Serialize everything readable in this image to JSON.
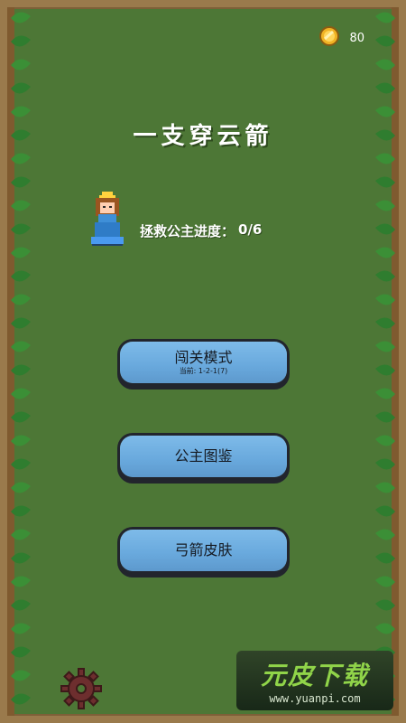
{
  "status_bar": {
    "coins": "80",
    "coin_icon": "coin-icon"
  },
  "game": {
    "title": "一支穿云箭",
    "rescue_label": "拯救公主进度：",
    "rescue_progress": "0/6"
  },
  "menu": {
    "challenge": {
      "label": "闯关模式",
      "sublabel": "当前: 1-2-1(7)"
    },
    "princess_gallery": {
      "label": "公主图鉴"
    },
    "bow_skins": {
      "label": "弓箭皮肤"
    }
  },
  "icons": {
    "settings": "gear-icon",
    "princess": "princess-icon"
  },
  "watermark": {
    "title": "元皮下载",
    "url": "www.yuanpi.com"
  },
  "colors": {
    "background": "#4d7736",
    "border": "#9a7a4c",
    "button": "#6eabdd",
    "button_outline": "#22252d",
    "vine_leaf": "#2f7d2f"
  }
}
